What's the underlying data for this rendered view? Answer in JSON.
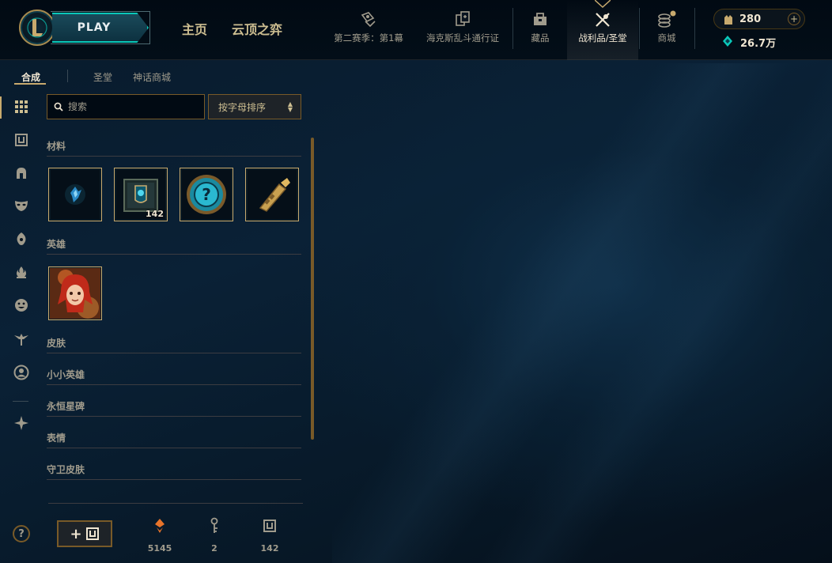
{
  "topbar": {
    "play_label": "PLAY",
    "nav": [
      {
        "label": "主页"
      },
      {
        "label": "云顶之弈"
      }
    ],
    "icon_nav": [
      {
        "label": "第二赛季：第1幕",
        "icon": "card-hand-icon"
      },
      {
        "label": "海克斯乱斗通行证",
        "icon": "pass-cards-icon"
      },
      {
        "label": "藏品",
        "icon": "collection-bag-icon"
      },
      {
        "label": "战利品/圣堂",
        "icon": "loot-crossed-tools-icon"
      },
      {
        "label": "商城",
        "icon": "store-coins-icon"
      }
    ],
    "active_tab": "战利品/圣堂",
    "riot_points": "280",
    "blue_essence": "26.7万"
  },
  "left": {
    "subtabs": [
      {
        "label": "合成",
        "active": true
      },
      {
        "label": "圣堂",
        "active": false
      },
      {
        "label": "神话商城",
        "active": false
      }
    ],
    "search_placeholder": "搜索",
    "sort_label": "按字母排序",
    "sections": [
      {
        "title": "材料"
      },
      {
        "title": "英雄"
      },
      {
        "title": "皮肤"
      },
      {
        "title": "小小英雄"
      },
      {
        "title": "永恒星碑"
      },
      {
        "title": "表情"
      },
      {
        "title": "守卫皮肤"
      }
    ],
    "materials": [
      {
        "name": "orange-essence-shard",
        "count": ""
      },
      {
        "name": "hextech-chest",
        "count": "142"
      },
      {
        "name": "mystery-orb",
        "count": ""
      },
      {
        "name": "hextech-key",
        "count": ""
      }
    ],
    "champions": [
      {
        "name": "annie-champion-shard",
        "count": ""
      }
    ],
    "footer": {
      "orange_essence": "5145",
      "keys": "2",
      "chests": "142"
    }
  },
  "colors": {
    "gold": "#c8aa6e",
    "dark_gold": "#785a28",
    "text": "#a09b8c",
    "bright_text": "#f0e6d2",
    "teal": "#0ac8b9"
  }
}
